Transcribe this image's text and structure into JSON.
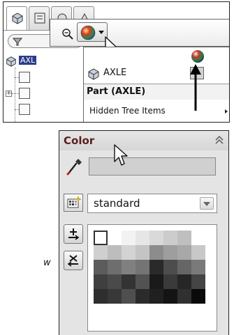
{
  "top_panel": {
    "tree": {
      "root_label": "AXL"
    },
    "popup": {
      "dropdown": {
        "body_label": "AXLE",
        "header": "Part (AXLE)",
        "hidden_tree": "Hidden Tree Items"
      }
    }
  },
  "color_panel": {
    "title": "Color",
    "palette": {
      "selected": "standard"
    },
    "swatch_colors": [
      "#ffffff",
      "#ffffff",
      "#f2f2f2",
      "#e6e6e6",
      "#d9d9d9",
      "#cccccc",
      "#bfbfbf",
      "#ffffff",
      "#cfcfcf",
      "#bdbdbd",
      "#d3d3d3",
      "#c4c4c4",
      "#8c8c8c",
      "#9e9e9e",
      "#a8a8a8",
      "#c8c8c8",
      "#5c5c5c",
      "#6e6e6e",
      "#808080",
      "#747474",
      "#2a2a2a",
      "#4d4d4d",
      "#666666",
      "#7a7a7a",
      "#3f3f3f",
      "#4a4a4a",
      "#333333",
      "#525252",
      "#1a1a1a",
      "#3a3a3a",
      "#262626",
      "#444444",
      "#2e2e2e",
      "#383838",
      "#4f4f4f",
      "#2b2b2b",
      "#202020",
      "#141414",
      "#303030",
      "#0a0a0a"
    ]
  },
  "side_label": "w"
}
